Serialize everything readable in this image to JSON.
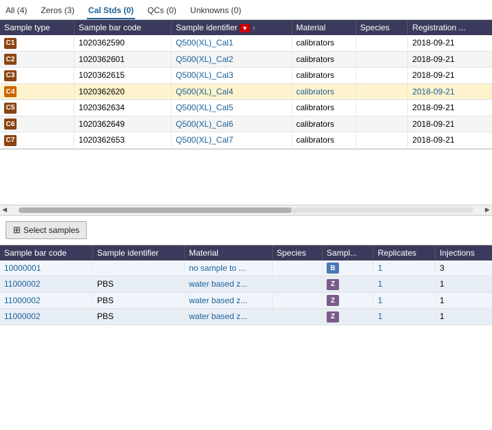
{
  "tabs": [
    {
      "label": "All (4)",
      "active": false
    },
    {
      "label": "Zeros (3)",
      "active": false
    },
    {
      "label": "Cal Stds (0)",
      "active": true
    },
    {
      "label": "QCs (0)",
      "active": false
    },
    {
      "label": "Unknowns (0)",
      "active": false
    }
  ],
  "top_table": {
    "columns": [
      "Sample type",
      "Sample bar code",
      "Sample identifier",
      "Material",
      "Species",
      "Registration ..."
    ],
    "rows": [
      {
        "badge": "C1",
        "color": "#8B4513",
        "barcode": "1020362590",
        "identifier": "Q500(XL)_Cal1",
        "material": "calibrators",
        "species": "",
        "registration": "2018-09-21",
        "highlighted": false
      },
      {
        "badge": "C2",
        "color": "#8B4513",
        "barcode": "1020362601",
        "identifier": "Q500(XL)_Cal2",
        "material": "calibrators",
        "species": "",
        "registration": "2018-09-21",
        "highlighted": false
      },
      {
        "badge": "C3",
        "color": "#8B4513",
        "barcode": "1020362615",
        "identifier": "Q500(XL)_Cal3",
        "material": "calibrators",
        "species": "",
        "registration": "2018-09-21",
        "highlighted": false
      },
      {
        "badge": "C4",
        "color": "#cc6600",
        "barcode": "1020362620",
        "identifier": "Q500(XL)_Cal4",
        "material": "calibrators",
        "species": "",
        "registration": "2018-09-21",
        "highlighted": true
      },
      {
        "badge": "C5",
        "color": "#8B4513",
        "barcode": "1020362634",
        "identifier": "Q500(XL)_Cal5",
        "material": "calibrators",
        "species": "",
        "registration": "2018-09-21",
        "highlighted": false
      },
      {
        "badge": "C6",
        "color": "#8B4513",
        "barcode": "1020362649",
        "identifier": "Q500(XL)_Cal6",
        "material": "calibrators",
        "species": "",
        "registration": "2018-09-21",
        "highlighted": false
      },
      {
        "badge": "C7",
        "color": "#8B4513",
        "barcode": "1020362653",
        "identifier": "Q500(XL)_Cal7",
        "material": "calibrators",
        "species": "",
        "registration": "2018-09-21",
        "highlighted": false
      }
    ]
  },
  "select_btn_label": "Select samples",
  "bottom_table": {
    "columns": [
      "Sample bar code",
      "Sample identifier",
      "Material",
      "Species",
      "Sampl...",
      "Replicates",
      "Injections"
    ],
    "rows": [
      {
        "barcode": "10000001",
        "identifier": "",
        "material": "no sample to ...",
        "species": "",
        "badge": "B",
        "badge_color": "#4a7ab5",
        "replicates": "1",
        "injections": "3"
      },
      {
        "barcode": "11000002",
        "identifier": "PBS",
        "material": "water based z...",
        "species": "",
        "badge": "Z",
        "badge_color": "#7a5c8a",
        "replicates": "1",
        "injections": "1"
      },
      {
        "barcode": "11000002",
        "identifier": "PBS",
        "material": "water based z...",
        "species": "",
        "badge": "Z",
        "badge_color": "#7a5c8a",
        "replicates": "1",
        "injections": "1"
      },
      {
        "barcode": "11000002",
        "identifier": "PBS",
        "material": "water based z...",
        "species": "",
        "badge": "Z",
        "badge_color": "#7a5c8a",
        "replicates": "1",
        "injections": "1"
      }
    ]
  }
}
